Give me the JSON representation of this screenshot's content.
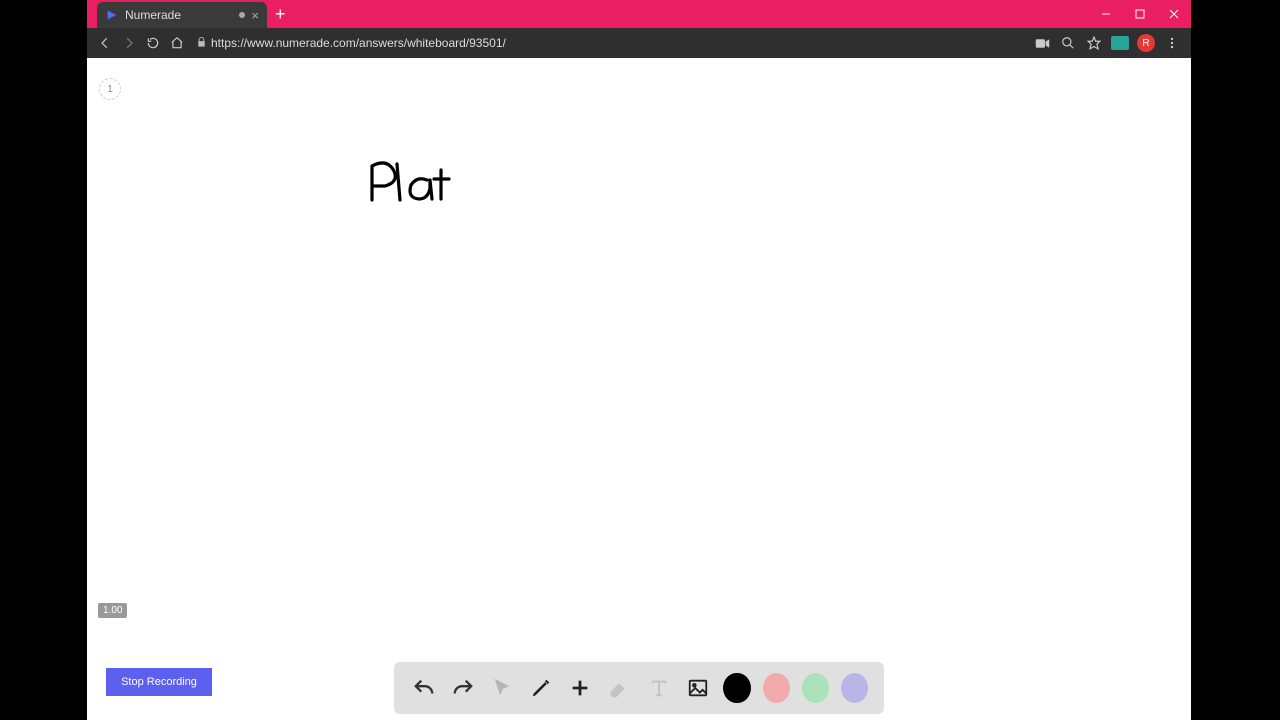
{
  "browser": {
    "tab_title": "Numerade",
    "url": "https://www.numerade.com/answers/whiteboard/93501/",
    "avatar_initial": "R"
  },
  "whiteboard": {
    "page_number": "1",
    "zoom_label": "1.00",
    "handwriting_text": "Plat"
  },
  "buttons": {
    "stop_recording": "Stop Recording"
  },
  "toolbar": {
    "colors": {
      "black": "#000000",
      "red": "#F2A9A9",
      "green": "#A9E2B8",
      "purple": "#B9B5E8"
    }
  }
}
